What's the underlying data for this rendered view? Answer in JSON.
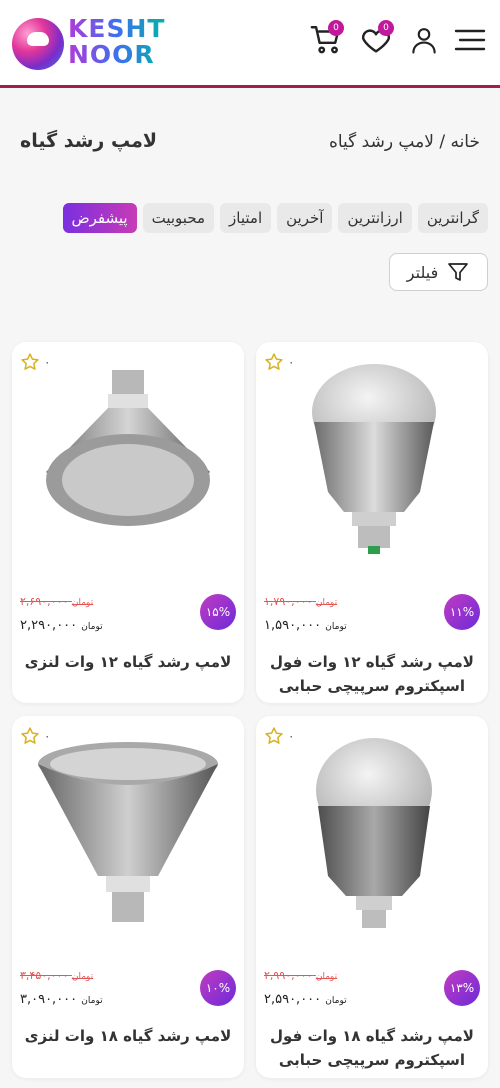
{
  "header": {
    "logo_line1": "KESHT",
    "logo_line2": "NOOR",
    "cart_count": "0",
    "wishlist_count": "0"
  },
  "breadcrumb": {
    "text": "خانه / لامپ رشد گیاه"
  },
  "page_title": "لامپ رشد گیاه",
  "sort": {
    "options": [
      "پیشفرض",
      "محبوبیت",
      "امتیاز",
      "آخرین",
      "ارزانترین",
      "گرانترین"
    ],
    "active": "پیشفرض"
  },
  "filter_label": "فیلتر",
  "currency": "تومان",
  "products": [
    {
      "name": "لامپ رشد گیاه ۱۲ وات فول اسپکتروم سرپیچی حبابی",
      "old_price": "۱,۷۹۰,۰۰۰",
      "new_price": "۱,۵۹۰,۰۰۰",
      "discount": "۱۱%",
      "rating_count": "۰",
      "image": "bulb-icon"
    },
    {
      "name": "لامپ رشد گیاه ۱۲ وات لنزی",
      "old_price": "۲,۶۹۰,۰۰۰",
      "new_price": "۲,۲۹۰,۰۰۰",
      "discount": "۱۵%",
      "rating_count": "۰",
      "image": "par-lamp-icon"
    },
    {
      "name": "لامپ رشد گیاه ۱۸ وات فول اسپکتروم سرپیچی حبابی",
      "old_price": "۲,۹۹۰,۰۰۰",
      "new_price": "۲,۵۹۰,۰۰۰",
      "discount": "۱۳%",
      "rating_count": "۰",
      "image": "bulb-icon"
    },
    {
      "name": "لامپ رشد گیاه ۱۸ وات لنزی",
      "old_price": "۳,۴۵۰,۰۰۰",
      "new_price": "۳,۰۹۰,۰۰۰",
      "discount": "۱۰%",
      "rating_count": "۰",
      "image": "par-lamp-icon"
    }
  ],
  "colors": {
    "accent": "#a51d4f",
    "gradient_start": "#7a2fe0",
    "gradient_end": "#c73bb6",
    "old_price": "#e25555"
  }
}
